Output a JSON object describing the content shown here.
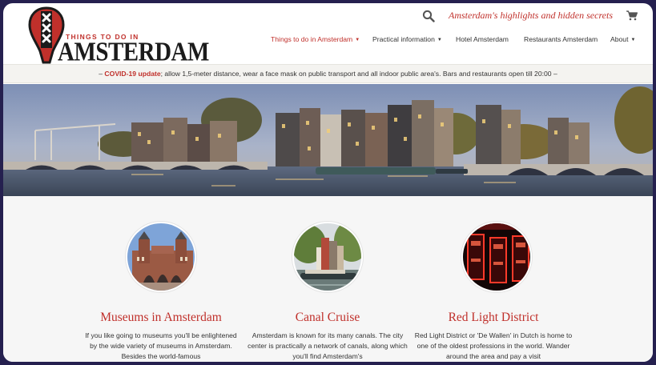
{
  "header": {
    "logo": {
      "name": "amsterdam-logo",
      "small_text": "THINGS TO DO IN",
      "big_text": "AMSTERDAM"
    },
    "tagline": "Amsterdam's highlights and hidden secrets",
    "icons": {
      "search": "search-icon",
      "cart": "shopping-cart-icon"
    },
    "nav": [
      {
        "label": "Things to do in Amsterdam",
        "has_dropdown": true,
        "active": true
      },
      {
        "label": "Practical information",
        "has_dropdown": true,
        "active": false
      },
      {
        "label": "Hotel Amsterdam",
        "has_dropdown": false,
        "active": false
      },
      {
        "label": "Restaurants Amsterdam",
        "has_dropdown": false,
        "active": false
      },
      {
        "label": "About",
        "has_dropdown": true,
        "active": false
      }
    ]
  },
  "covid": {
    "prefix": "– ",
    "highlight": "COVID-19 update",
    "text": "; allow 1,5-meter distance, wear a face mask on public transport and all indoor public area's. Bars and restaurants open till 20:00 –"
  },
  "cards": [
    {
      "title": "Museums in Amsterdam",
      "text": "If you like going to museums you'll be enlightened by the wide variety of museums in Amsterdam. Besides the world-famous",
      "image": "rijksmuseum-photo"
    },
    {
      "title": "Canal Cruise",
      "text": "Amsterdam is known for its many canals. The city center is practically a network of canals, along which you'll find Amsterdam's",
      "image": "canal-photo"
    },
    {
      "title": "Red Light District",
      "text": "Red Light District or 'De Wallen' in Dutch is home to one of the oldest professions in the world. Wander around the area and pay a visit",
      "image": "red-light-district-photo"
    }
  ],
  "colors": {
    "accent": "#c0302b",
    "frame": "#25204f",
    "text": "#333333"
  }
}
